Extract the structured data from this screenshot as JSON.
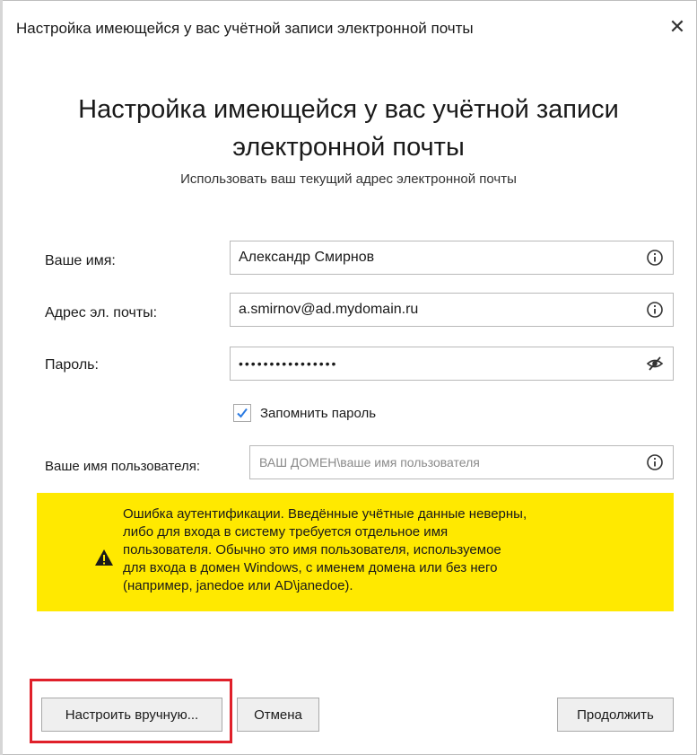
{
  "window": {
    "title": "Настройка имеющейся у вас учётной записи электронной почты",
    "close_glyph": "✕"
  },
  "header": {
    "title_line1": "Настройка имеющейся у вас учётной записи",
    "title_line2": "электронной почты",
    "subtitle": "Использовать ваш текущий адрес электронной почты"
  },
  "form": {
    "name_label": "Ваше имя:",
    "name_value": "Александр Смирнов",
    "email_label": "Адрес эл. почты:",
    "email_value": "a.smirnov@ad.mydomain.ru",
    "password_label": "Пароль:",
    "password_value": "••••••••••••••••",
    "remember_label": "Запомнить пароль",
    "remember_checked": true,
    "username_label": "Ваше имя пользователя:",
    "username_placeholder": "ВАШ ДОМЕН\\ваше имя пользователя"
  },
  "alert": {
    "color": "#ffe900",
    "line1": "Ошибка аутентификации. Введённые учётные данные неверны,",
    "line2": "либо для входа в систему требуется отдельное имя",
    "line3": "пользователя. Обычно это имя пользователя, используемое",
    "line4": "для входа в домен Windows, с именем домена или без него",
    "line5": "(например, janedoe или AD\\janedoe)."
  },
  "buttons": {
    "manual": "Настроить вручную...",
    "cancel": "Отмена",
    "continue": "Продолжить"
  },
  "icons": {
    "info": "info-icon",
    "eye": "eye-slash-icon",
    "warning": "warning-icon",
    "check": "check-icon"
  },
  "accent": {
    "highlight_border": "#e0202a",
    "check_color": "#2a7ae2"
  }
}
